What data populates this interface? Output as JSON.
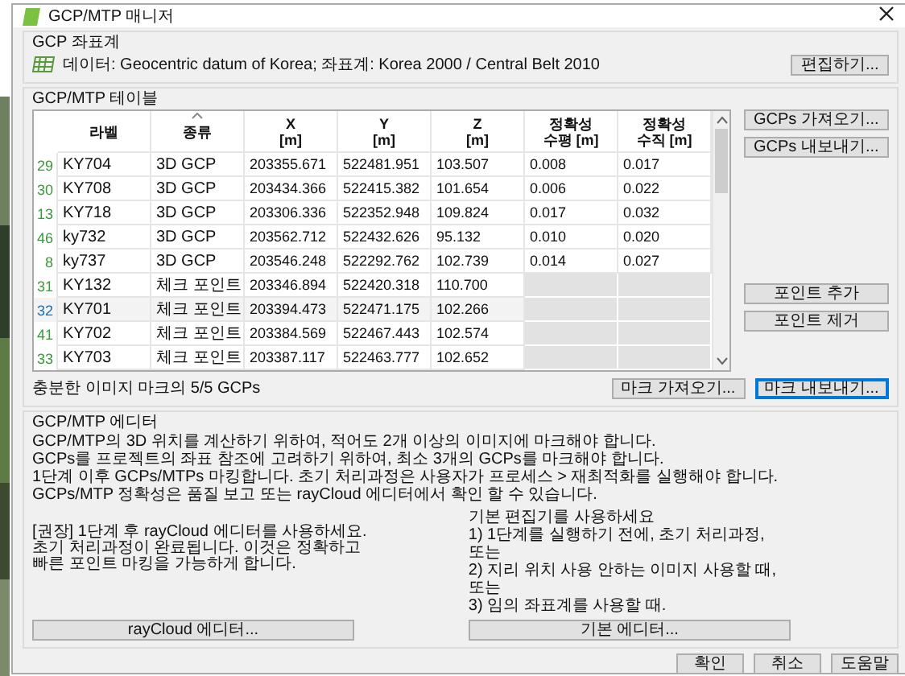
{
  "window": {
    "title": "GCP/MTP 매니저"
  },
  "coordinate_system": {
    "heading": "GCP 좌표계",
    "text": "데이터: Geocentric datum of Korea; 좌표계: Korea 2000 / Central Belt 2010",
    "button": "편집하기..."
  },
  "table": {
    "heading": "GCP/MTP 테이블",
    "columns": [
      {
        "label": "라벨",
        "sorted": false
      },
      {
        "label": "종류",
        "sorted": true
      },
      {
        "label": "X\n[m]",
        "sorted": false
      },
      {
        "label": "Y\n[m]",
        "sorted": false
      },
      {
        "label": "Z\n[m]",
        "sorted": false
      },
      {
        "label": "정확성\n수평 [m]",
        "sorted": false
      },
      {
        "label": "정확성\n수직 [m]",
        "sorted": false
      }
    ],
    "rows": [
      {
        "number": "29",
        "kind": "gcp",
        "selected": false,
        "cells": [
          "KY704",
          "3D GCP",
          "203355.671",
          "522481.951",
          "103.507",
          "0.008",
          "0.017"
        ]
      },
      {
        "number": "30",
        "kind": "gcp",
        "selected": false,
        "cells": [
          "KY708",
          "3D GCP",
          "203434.366",
          "522415.382",
          "101.654",
          "0.006",
          "0.022"
        ]
      },
      {
        "number": "13",
        "kind": "gcp",
        "selected": false,
        "cells": [
          "KY718",
          "3D GCP",
          "203306.336",
          "522352.948",
          "109.824",
          "0.017",
          "0.032"
        ]
      },
      {
        "number": "46",
        "kind": "gcp",
        "selected": false,
        "cells": [
          "ky732",
          "3D GCP",
          "203562.712",
          "522432.626",
          "95.132",
          "0.010",
          "0.020"
        ]
      },
      {
        "number": "8",
        "kind": "gcp",
        "selected": false,
        "cells": [
          "ky737",
          "3D GCP",
          "203546.248",
          "522292.762",
          "102.739",
          "0.014",
          "0.027"
        ]
      },
      {
        "number": "31",
        "kind": "checkpoint",
        "selected": false,
        "cells": [
          "KY132",
          "체크 포인트",
          "203346.894",
          "522420.318",
          "110.700"
        ]
      },
      {
        "number": "32",
        "kind": "checkpoint",
        "selected": true,
        "cells": [
          "KY701",
          "체크 포인트",
          "203394.473",
          "522471.175",
          "102.266"
        ]
      },
      {
        "number": "41",
        "kind": "checkpoint",
        "selected": false,
        "cells": [
          "KY702",
          "체크 포인트",
          "203384.569",
          "522467.443",
          "102.574"
        ]
      },
      {
        "number": "33",
        "kind": "checkpoint",
        "selected": false,
        "cells": [
          "KY703",
          "체크 포인트",
          "203387.117",
          "522463.777",
          "102.652"
        ]
      }
    ],
    "side_buttons_top": [
      "GCPs 가져오기...",
      "GCPs 내보내기..."
    ],
    "side_buttons_bottom": [
      "포인트 추가",
      "포인트 제거"
    ],
    "status": "충분한 이미지 마크의 5/5 GCPs",
    "mark_buttons": [
      {
        "label": "마크 가져오기...",
        "focused": false
      },
      {
        "label": "마크 내보내기...",
        "focused": true
      }
    ]
  },
  "editor": {
    "heading": "GCP/MTP 에디터",
    "lines": [
      "GCP/MTP의 3D 위치를 계산하기 위하여, 적어도 2개 이상의 이미지에 마크해야 합니다.",
      "GCPs를 프로젝트의 좌표 참조에 고려하기 위하여, 최소 3개의 GCPs를 마크해야 합니다.",
      "1단계 이후 GCPs/MTPs 마킹합니다. 초기 처리과정은 사용자가 프로세스 > 재최적화를 실행해야 합니다.",
      "GCPs/MTP 정확성은 품질 보고 또는 rayCloud 에디터에서 확인 할 수 있습니다."
    ],
    "left_note": "[권장] 1단계 후 rayCloud 에디터를 사용하세요. 초기 처리과정이 완료됩니다. 이것은 정확하고 빠른 포인트 마킹을 가능하게 합니다.",
    "left_button": "rayCloud 에디터...",
    "right_lines": [
      "기본 편집기를 사용하세요",
      "1) 1단계를 실행하기 전에, 초기 처리과정,",
      "또는",
      "2) 지리 위치 사용 안하는 이미지 사용할 때,",
      "또는",
      "3) 임의 좌표계를 사용할 때."
    ],
    "right_button": "기본 에디터..."
  },
  "footer_buttons": [
    "확인",
    "취소",
    "도움말"
  ]
}
